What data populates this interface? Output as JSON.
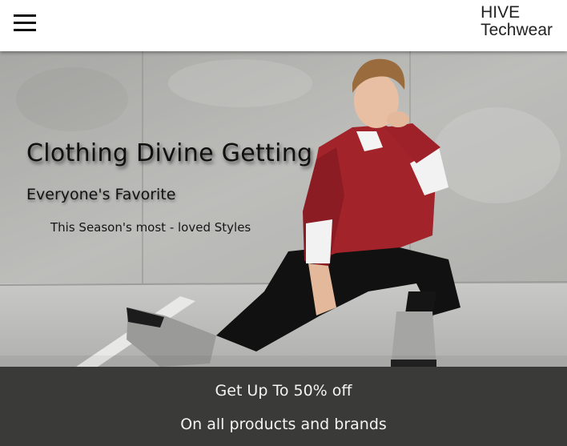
{
  "header": {
    "brand_line1": "HIVE",
    "brand_line2": "Techwear",
    "menu_icon": "hamburger-menu-icon"
  },
  "hero": {
    "headline": "Clothing Divine Getting",
    "subheadline": "Everyone's Favorite",
    "tagline": "This Season's most - loved Styles"
  },
  "promo": {
    "line1": "Get Up To 50% off",
    "line2": "On all products and brands"
  },
  "colors": {
    "promo_background": "#3a3a38",
    "sweater_red": "#a3232b",
    "wall_grey": "#b9b9b7"
  }
}
